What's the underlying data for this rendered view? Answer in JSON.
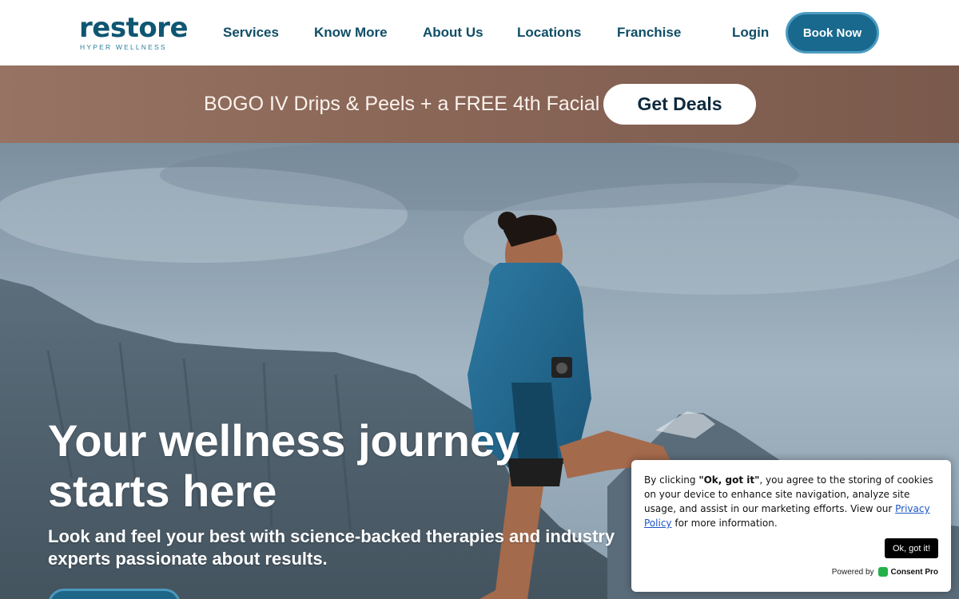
{
  "brand": {
    "logo_word": "restore",
    "logo_tagline": "HYPER WELLNESS"
  },
  "nav": {
    "items": [
      {
        "label": "Services"
      },
      {
        "label": "Know More"
      },
      {
        "label": "About Us"
      },
      {
        "label": "Locations"
      },
      {
        "label": "Franchise"
      }
    ],
    "login_label": "Login",
    "book_label": "Book Now"
  },
  "promo": {
    "text": "BOGO IV Drips & Peels + a FREE 4th Facial",
    "button_label": "Get Deals"
  },
  "hero": {
    "title": "Your wellness journey starts here",
    "subtitle": "Look and feel your best with science-backed therapies and industry experts passionate about results."
  },
  "cookie": {
    "prefix": "By clicking ",
    "quoted": "\"Ok, got it\"",
    "body": ", you agree to the storing of cookies on your device to enhance site navigation, analyze site usage, and assist in our marketing efforts. View our ",
    "link_label": "Privacy Policy",
    "suffix": " for more information.",
    "ok_label": "Ok, got it!",
    "powered_by": "Powered by",
    "provider": "Consent Pro"
  },
  "colors": {
    "brand_dark": "#0f5672",
    "button_blue": "#19698e",
    "promo_brown": "#8a6657",
    "consent_green": "#24b14a"
  }
}
